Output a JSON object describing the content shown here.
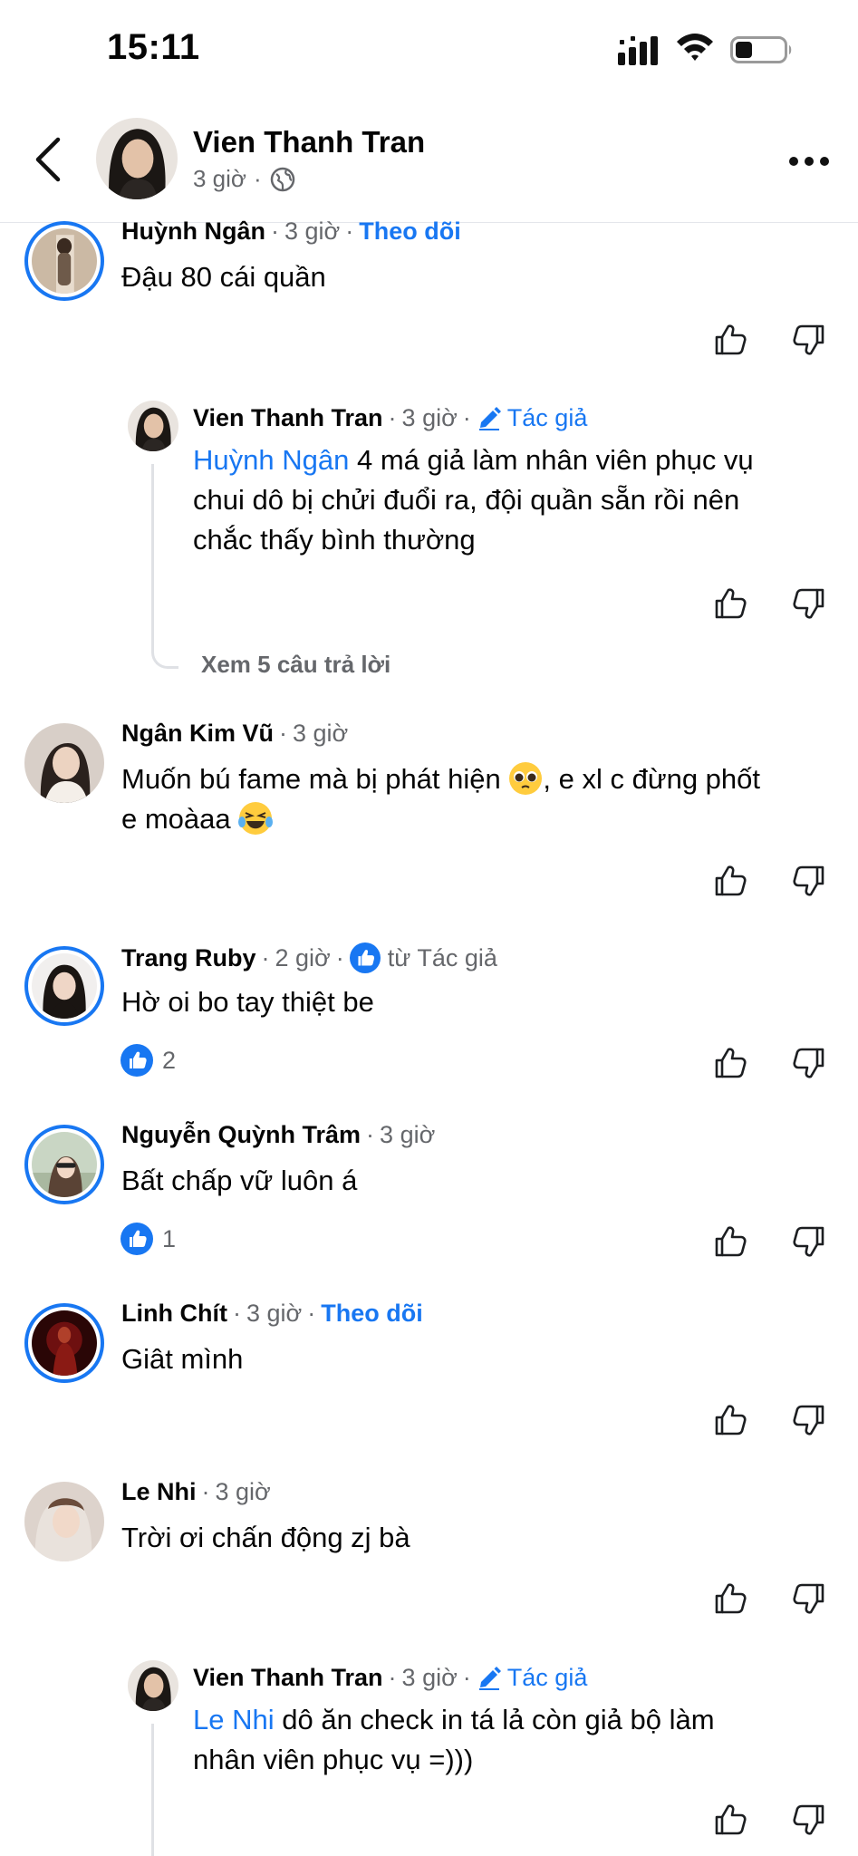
{
  "status_bar": {
    "time": "15:11"
  },
  "post_header": {
    "author": "Vien Thanh Tran",
    "time": "3 giờ",
    "separator": "·"
  },
  "colors": {
    "accent": "#1877f2",
    "secondary_text": "#65676b",
    "primary_text": "#050505"
  },
  "comments": [
    {
      "name": "Huỳnh Ngân",
      "time": "3 giờ",
      "follow": "Theo dõi",
      "text": "Đậu 80 cái quần"
    },
    {
      "reply": true,
      "name": "Vien Thanh Tran",
      "time": "3 giờ",
      "author_badge": "Tác giả",
      "mention": "Huỳnh Ngân",
      "text_lines": [
        "4 má giả làm nhân viên phục vụ",
        "chui dô bị chửi đuổi ra, đội quần sẵn rồi nên",
        "chắc thấy bình thường"
      ],
      "view_replies": "Xem 5 câu trả lời"
    },
    {
      "name": "Ngân Kim Vũ",
      "time": "3 giờ",
      "text_line1": "Muốn bú fame mà bị phát hiện",
      "text_line1_tail": ", e xl c đừng phốt",
      "text_line2": "e moàaa",
      "emojis": [
        "pleading-face-emoji",
        "laughing-tears-emoji"
      ]
    },
    {
      "name": "Trang Ruby",
      "time": "2 giờ",
      "from_author": "từ Tác giả",
      "text": "Hờ oi bo tay thiệt be",
      "likes": "2"
    },
    {
      "name": "Nguyễn Quỳnh Trâm",
      "time": "3 giờ",
      "text": "Bất chấp vữ luôn á",
      "likes": "1"
    },
    {
      "name": "Linh Chít",
      "time": "3 giờ",
      "follow": "Theo dõi",
      "text": "Giât mình"
    },
    {
      "name": "Le Nhi",
      "time": "3 giờ",
      "text": "Trời ơi chấn động zj bà"
    },
    {
      "reply": true,
      "name": "Vien Thanh Tran",
      "time": "3 giờ",
      "author_badge": "Tác giả",
      "mention": "Le Nhi",
      "text_lines": [
        "dô ăn check in tá lả còn giả bộ làm",
        "nhân viên phục vụ =)))"
      ]
    }
  ]
}
